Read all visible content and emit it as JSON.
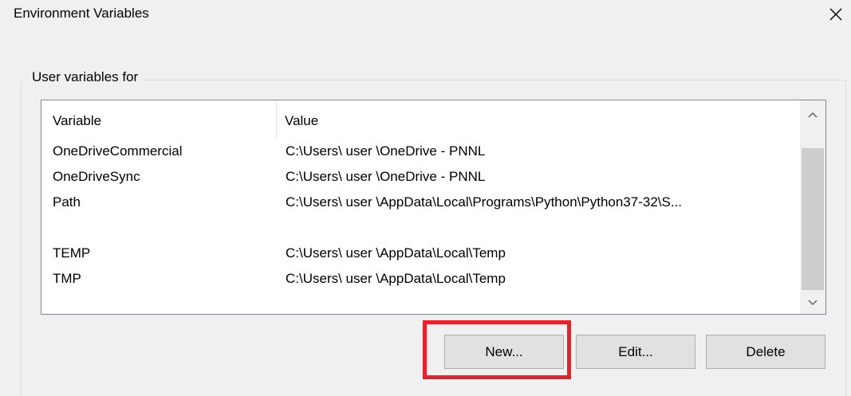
{
  "window": {
    "title": "Environment Variables",
    "close_icon": "close-icon"
  },
  "user_group": {
    "label": "User variables for"
  },
  "table": {
    "columns": [
      "Variable",
      "Value"
    ],
    "rows": [
      {
        "name": "OneDriveCommercial",
        "value": "C:\\Users\\  user  \\OneDrive - PNNL"
      },
      {
        "name": "OneDriveSync",
        "value": "C:\\Users\\  user  \\OneDrive - PNNL"
      },
      {
        "name": "Path",
        "value": "C:\\Users\\  user   \\AppData\\Local\\Programs\\Python\\Python37-32\\S..."
      },
      {
        "name": "",
        "value": ""
      },
      {
        "name": "TEMP",
        "value": "C:\\Users\\  user  \\AppData\\Local\\Temp"
      },
      {
        "name": "TMP",
        "value": "C:\\Users\\  user  \\AppData\\Local\\Temp"
      }
    ]
  },
  "buttons": {
    "new_label": "New...",
    "edit_label": "Edit...",
    "delete_label": "Delete"
  },
  "colors": {
    "highlight": "#e8202a",
    "dialog_background": "#f0f0f0",
    "button_face": "#e1e1e1"
  }
}
